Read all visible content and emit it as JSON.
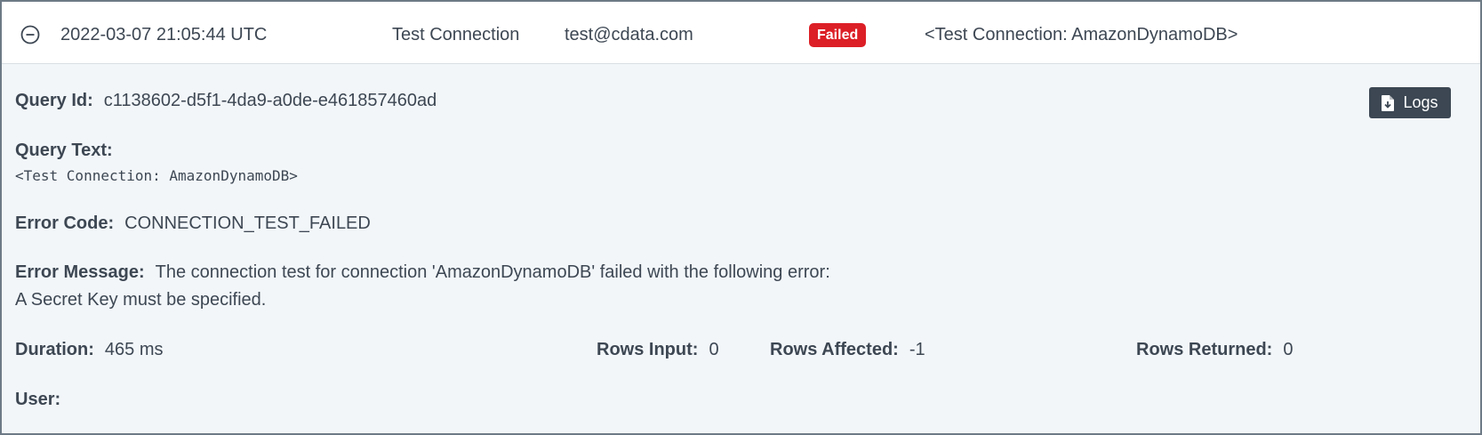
{
  "header": {
    "timestamp": "2022-03-07 21:05:44 UTC",
    "query_type": "Test Connection",
    "user_email": "test@cdata.com",
    "status": "Failed",
    "query_summary": "<Test Connection: AmazonDynamoDB>",
    "collapse_icon": "minus-circle-icon",
    "status_color": "#dc1f26"
  },
  "details": {
    "query_id_label": "Query Id:",
    "query_id": "c1138602-d5f1-4da9-a0de-e461857460ad",
    "query_text_label": "Query Text:",
    "query_text": "<Test Connection: AmazonDynamoDB>",
    "error_code_label": "Error Code:",
    "error_code": "CONNECTION_TEST_FAILED",
    "error_message_label": "Error Message:",
    "error_message_line1": "The connection test for connection 'AmazonDynamoDB' failed with the following error:",
    "error_message_line2": "A Secret Key must be specified.",
    "duration_label": "Duration:",
    "duration": "465 ms",
    "rows_input_label": "Rows Input:",
    "rows_input": "0",
    "rows_affected_label": "Rows Affected:",
    "rows_affected": "-1",
    "rows_returned_label": "Rows Returned:",
    "rows_returned": "0",
    "user_label": "User:",
    "user": ""
  },
  "actions": {
    "logs_label": "Logs",
    "logs_icon": "file-download-icon"
  }
}
